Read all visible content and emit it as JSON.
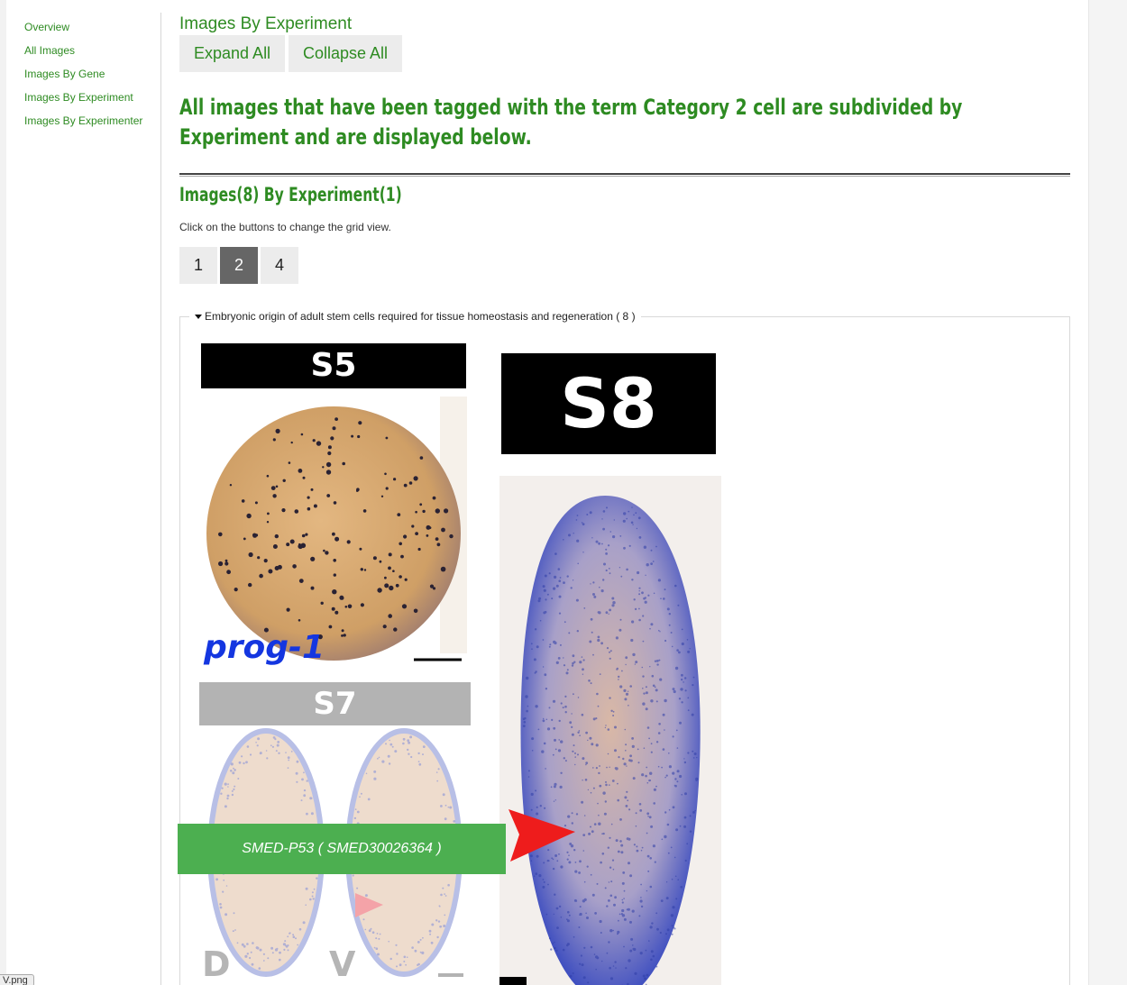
{
  "sidebar": {
    "items": [
      {
        "label": "Overview"
      },
      {
        "label": "All Images"
      },
      {
        "label": "Images By Gene"
      },
      {
        "label": "Images By Experiment"
      },
      {
        "label": "Images By Experimenter"
      }
    ]
  },
  "main": {
    "section_title": "Images By Experiment",
    "expand_label": "Expand All",
    "collapse_label": "Collapse All",
    "headline": "All images that have been tagged with the term Category 2 cell are subdivided by Experiment and are displayed below.",
    "count_title": "Images(8) By Experiment(1)",
    "hint": "Click on the buttons to change the grid view.",
    "grid_buttons": [
      "1",
      "2",
      "4"
    ],
    "active_grid": "2"
  },
  "experiment": {
    "legend": "Embryonic origin of adult stem cells required for tissue homeostasis and regeneration ( 8 )",
    "images": [
      {
        "stage": "S5",
        "gene_label": "prog-1"
      },
      {
        "stage": "S8"
      },
      {
        "stage": "S7",
        "panel_labels": [
          "D",
          "V"
        ]
      }
    ],
    "hover_gene": "SMED-P53 ( SMED30026364 )"
  },
  "download_tab": "V.png",
  "colors": {
    "link_green": "#2e8b22",
    "overlay_green": "#4caf50",
    "stain_blue": "#3a4bb0",
    "embryo_tan": "#d9a96f"
  }
}
